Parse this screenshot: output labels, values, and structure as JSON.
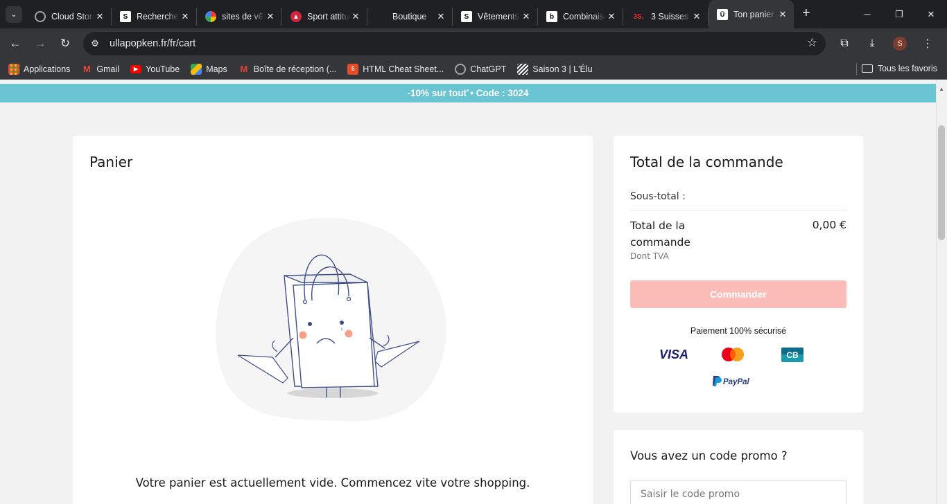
{
  "browser": {
    "tabs": [
      {
        "title": "Cloud Storage",
        "icon": "chatgpt-icon"
      },
      {
        "title": "Recherche",
        "icon": "s-logo-icon"
      },
      {
        "title": "sites de vêtements",
        "icon": "google-icon"
      },
      {
        "title": "Sport attitude",
        "icon": "sport-icon"
      },
      {
        "title": "Boutique",
        "icon": "boutique-icon"
      },
      {
        "title": "Vêtements",
        "icon": "s-logo-icon"
      },
      {
        "title": "Combinaisons",
        "icon": "b-logo-icon"
      },
      {
        "title": "3 Suisses |",
        "icon": "3s-icon",
        "favicon_text": "3S."
      },
      {
        "title": "Ton panier",
        "icon": "ullapopken-icon",
        "active": true
      }
    ],
    "url": "ullapopken.fr/fr/cart",
    "avatar_letter": "S",
    "bookmarks": [
      {
        "label": "Applications",
        "icon": "apps-grid-icon"
      },
      {
        "label": "Gmail",
        "icon": "gmail-icon"
      },
      {
        "label": "YouTube",
        "icon": "youtube-icon"
      },
      {
        "label": "Maps",
        "icon": "maps-icon"
      },
      {
        "label": "Boîte de réception (...",
        "icon": "gmail-icon"
      },
      {
        "label": "HTML Cheat Sheet...",
        "icon": "html-icon"
      },
      {
        "label": "ChatGPT",
        "icon": "chatgpt-icon"
      },
      {
        "label": "Saison 3 | L'Élu",
        "icon": "stripes-icon"
      }
    ],
    "all_bookmarks": "Tous les favoris"
  },
  "page": {
    "banner": {
      "text": "-10% sur tout",
      "sup": "*",
      "code": " • Code : 3024"
    },
    "cart": {
      "title": "Panier",
      "empty_message": "Votre panier est actuellement vide. Commencez vite votre shopping."
    },
    "summary": {
      "title": "Total de la commande",
      "subtotal_label": "Sous-total :",
      "total_label": "Total de la commande",
      "total_value": "0,00 €",
      "vat_note": "Dont TVA",
      "order_button": "Commander",
      "secure_text": "Paiement 100% sécurisé",
      "payment_methods": [
        "VISA",
        "Mastercard",
        "CB",
        "PayPal"
      ]
    },
    "promo": {
      "title": "Vous avez un code promo ?",
      "placeholder": "Saisir le code promo"
    }
  },
  "colors": {
    "banner": "#6ac5d3",
    "order_button_disabled": "#fcbdb8",
    "visa": "#1a1f71",
    "paypal_dark": "#253b80",
    "paypal_light": "#179bd7"
  }
}
